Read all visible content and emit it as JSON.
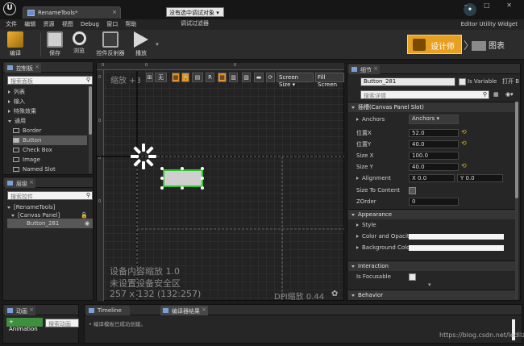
{
  "window": {
    "tab_title": "RenameTools*",
    "project_name": "Editor Utility Widget",
    "ue_logo": "U",
    "win_controls": "– □ ✕"
  },
  "menu": [
    "文件",
    "编辑",
    "资源",
    "视图",
    "Debug",
    "窗口",
    "帮助"
  ],
  "toolbar": {
    "compile": "编译",
    "save": "保存",
    "browse": "浏览",
    "widget_reflector": "控件反射器",
    "play": "播放",
    "debug_select": "没有选中调试对象",
    "debug_filter": "调试过滤器",
    "designer": "设计师",
    "graph": "图表",
    "chevron": "〉"
  },
  "palette": {
    "tab": "控制板",
    "search_placeholder": "搜索面板",
    "items": [
      {
        "label": "列表",
        "kind": "group-collapsed"
      },
      {
        "label": "输入",
        "kind": "group-collapsed"
      },
      {
        "label": "特殊效果",
        "kind": "group-collapsed"
      },
      {
        "label": "通用",
        "kind": "group-expanded"
      },
      {
        "label": "Border",
        "kind": "widget"
      },
      {
        "label": "Button",
        "kind": "widget",
        "selected": true
      },
      {
        "label": "Check Box",
        "kind": "widget"
      },
      {
        "label": "Image",
        "kind": "widget"
      },
      {
        "label": "Named Slot",
        "kind": "widget"
      }
    ]
  },
  "hierarchy": {
    "tab": "层级",
    "search_placeholder": "搜索控件",
    "items": [
      {
        "label": "[RenameTools]"
      },
      {
        "label": "[Canvas Panel]"
      },
      {
        "label": "Button_281",
        "selected": true
      }
    ]
  },
  "designer": {
    "zoom": "缩放 +3",
    "none_btn": "无",
    "r_btn": "R",
    "screen_size": "Screen Size",
    "fill_screen": "Fill Screen",
    "ruler_top": [
      "0",
      "0",
      "0"
    ],
    "ruler_left": [
      "0",
      "0",
      "0",
      "0"
    ],
    "device_content_scale": "设备内容缩放 1.0",
    "no_safe_zone": "未设置设备安全区",
    "resolution": "257 x 132 (132:257)",
    "dpi_scale": "DPI缩放 0.44",
    "gear": "✿"
  },
  "details": {
    "tab": "细节",
    "widget_name": "Button_281",
    "is_variable": "Is Variable",
    "open_btn": "打开 B",
    "search_placeholder": "搜索详情",
    "slot_section": "插槽(Canvas Panel Slot)",
    "anchors_label": "Anchors",
    "anchors_value": "Anchors",
    "fields": [
      {
        "label": "位置X",
        "value": "52.0"
      },
      {
        "label": "位置Y",
        "value": "40.0"
      },
      {
        "label": "Size X",
        "value": "100.0"
      },
      {
        "label": "Size Y",
        "value": "40.0"
      }
    ],
    "alignment_label": "Alignment",
    "alignment_x": "X  0.0",
    "alignment_y": "Y  0.0",
    "size_to_content": "Size To Content",
    "zorder_label": "ZOrder",
    "zorder_value": "0",
    "appearance_section": "Appearance",
    "style": "Style",
    "color_opacity": "Color and Opacity",
    "background_color": "Background Color",
    "interaction_section": "Interaction",
    "is_focusable": "Is Focusable",
    "behavior_section": "Behavior"
  },
  "bottom": {
    "anim_tab": "动画",
    "add_animation": "+ Animation",
    "anim_search": "搜索动画",
    "timeline_tab": "Timeline",
    "compiler_tab": "编译器结果",
    "compile_message": "• 编译模板已成功创建。",
    "watermark": "https://blog.csdn.net/ledllzc"
  },
  "colors": {
    "accent": "#e8a020",
    "selected_widget_border": "#2ec42e",
    "panel_bg": "#262626"
  }
}
